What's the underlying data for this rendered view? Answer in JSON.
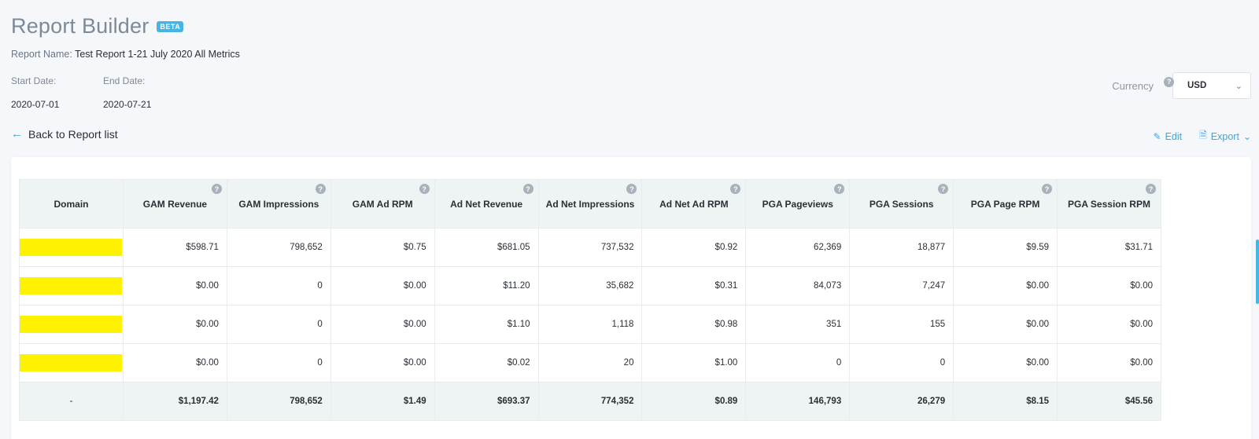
{
  "header": {
    "title": "Report Builder",
    "badge": "BETA"
  },
  "report": {
    "name_label": "Report Name:",
    "name_value": "Test Report 1-21 July 2020 All Metrics"
  },
  "dates": {
    "start_label": "Start Date:",
    "start_value": "2020-07-01",
    "end_label": "End Date:",
    "end_value": "2020-07-21"
  },
  "currency": {
    "label": "Currency",
    "help": "?",
    "selected": "USD"
  },
  "nav": {
    "back_label": "Back to Report list"
  },
  "actions": {
    "edit_label": "Edit",
    "export_label": "Export"
  },
  "table": {
    "columns": [
      "Domain",
      "GAM Revenue",
      "GAM Impressions",
      "GAM Ad RPM",
      "Ad Net Revenue",
      "Ad Net Impressions",
      "Ad Net Ad RPM",
      "PGA Pageviews",
      "PGA Sessions",
      "PGA Page RPM",
      "PGA Session RPM"
    ],
    "help": "?",
    "rows": [
      [
        "",
        "$598.71",
        "798,652",
        "$0.75",
        "$681.05",
        "737,532",
        "$0.92",
        "62,369",
        "18,877",
        "$9.59",
        "$31.71"
      ],
      [
        "",
        "$0.00",
        "0",
        "$0.00",
        "$11.20",
        "35,682",
        "$0.31",
        "84,073",
        "7,247",
        "$0.00",
        "$0.00"
      ],
      [
        "",
        "$0.00",
        "0",
        "$0.00",
        "$1.10",
        "1,118",
        "$0.98",
        "351",
        "155",
        "$0.00",
        "$0.00"
      ],
      [
        "",
        "$0.00",
        "0",
        "$0.00",
        "$0.02",
        "20",
        "$1.00",
        "0",
        "0",
        "$0.00",
        "$0.00"
      ]
    ],
    "total": [
      "-",
      "$1,197.42",
      "798,652",
      "$1.49",
      "$693.37",
      "774,352",
      "$0.89",
      "146,793",
      "26,279",
      "$8.15",
      "$45.56"
    ]
  },
  "colors": {
    "accent": "#3aa8dc",
    "redaction": "#fff200",
    "header_bg": "#eef3f4"
  }
}
